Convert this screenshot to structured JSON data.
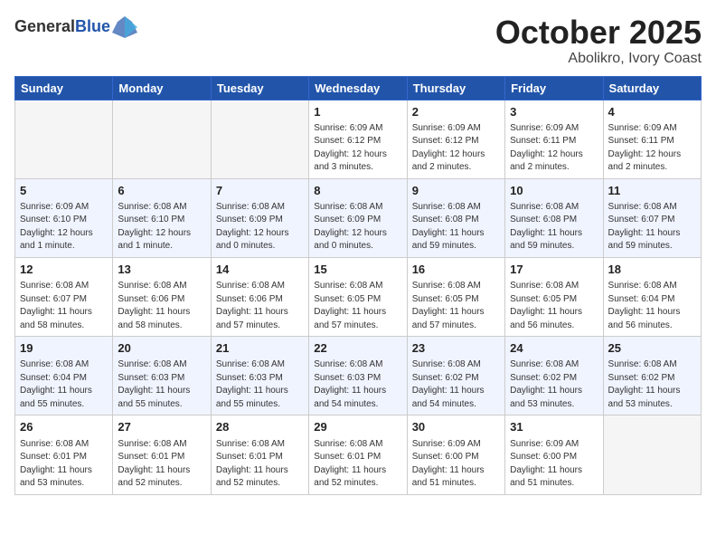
{
  "logo": {
    "general": "General",
    "blue": "Blue"
  },
  "header": {
    "month": "October 2025",
    "location": "Abolikro, Ivory Coast"
  },
  "weekdays": [
    "Sunday",
    "Monday",
    "Tuesday",
    "Wednesday",
    "Thursday",
    "Friday",
    "Saturday"
  ],
  "weeks": [
    [
      {
        "day": "",
        "info": ""
      },
      {
        "day": "",
        "info": ""
      },
      {
        "day": "",
        "info": ""
      },
      {
        "day": "1",
        "info": "Sunrise: 6:09 AM\nSunset: 6:12 PM\nDaylight: 12 hours and 3 minutes."
      },
      {
        "day": "2",
        "info": "Sunrise: 6:09 AM\nSunset: 6:12 PM\nDaylight: 12 hours and 2 minutes."
      },
      {
        "day": "3",
        "info": "Sunrise: 6:09 AM\nSunset: 6:11 PM\nDaylight: 12 hours and 2 minutes."
      },
      {
        "day": "4",
        "info": "Sunrise: 6:09 AM\nSunset: 6:11 PM\nDaylight: 12 hours and 2 minutes."
      }
    ],
    [
      {
        "day": "5",
        "info": "Sunrise: 6:09 AM\nSunset: 6:10 PM\nDaylight: 12 hours and 1 minute."
      },
      {
        "day": "6",
        "info": "Sunrise: 6:08 AM\nSunset: 6:10 PM\nDaylight: 12 hours and 1 minute."
      },
      {
        "day": "7",
        "info": "Sunrise: 6:08 AM\nSunset: 6:09 PM\nDaylight: 12 hours and 0 minutes."
      },
      {
        "day": "8",
        "info": "Sunrise: 6:08 AM\nSunset: 6:09 PM\nDaylight: 12 hours and 0 minutes."
      },
      {
        "day": "9",
        "info": "Sunrise: 6:08 AM\nSunset: 6:08 PM\nDaylight: 11 hours and 59 minutes."
      },
      {
        "day": "10",
        "info": "Sunrise: 6:08 AM\nSunset: 6:08 PM\nDaylight: 11 hours and 59 minutes."
      },
      {
        "day": "11",
        "info": "Sunrise: 6:08 AM\nSunset: 6:07 PM\nDaylight: 11 hours and 59 minutes."
      }
    ],
    [
      {
        "day": "12",
        "info": "Sunrise: 6:08 AM\nSunset: 6:07 PM\nDaylight: 11 hours and 58 minutes."
      },
      {
        "day": "13",
        "info": "Sunrise: 6:08 AM\nSunset: 6:06 PM\nDaylight: 11 hours and 58 minutes."
      },
      {
        "day": "14",
        "info": "Sunrise: 6:08 AM\nSunset: 6:06 PM\nDaylight: 11 hours and 57 minutes."
      },
      {
        "day": "15",
        "info": "Sunrise: 6:08 AM\nSunset: 6:05 PM\nDaylight: 11 hours and 57 minutes."
      },
      {
        "day": "16",
        "info": "Sunrise: 6:08 AM\nSunset: 6:05 PM\nDaylight: 11 hours and 57 minutes."
      },
      {
        "day": "17",
        "info": "Sunrise: 6:08 AM\nSunset: 6:05 PM\nDaylight: 11 hours and 56 minutes."
      },
      {
        "day": "18",
        "info": "Sunrise: 6:08 AM\nSunset: 6:04 PM\nDaylight: 11 hours and 56 minutes."
      }
    ],
    [
      {
        "day": "19",
        "info": "Sunrise: 6:08 AM\nSunset: 6:04 PM\nDaylight: 11 hours and 55 minutes."
      },
      {
        "day": "20",
        "info": "Sunrise: 6:08 AM\nSunset: 6:03 PM\nDaylight: 11 hours and 55 minutes."
      },
      {
        "day": "21",
        "info": "Sunrise: 6:08 AM\nSunset: 6:03 PM\nDaylight: 11 hours and 55 minutes."
      },
      {
        "day": "22",
        "info": "Sunrise: 6:08 AM\nSunset: 6:03 PM\nDaylight: 11 hours and 54 minutes."
      },
      {
        "day": "23",
        "info": "Sunrise: 6:08 AM\nSunset: 6:02 PM\nDaylight: 11 hours and 54 minutes."
      },
      {
        "day": "24",
        "info": "Sunrise: 6:08 AM\nSunset: 6:02 PM\nDaylight: 11 hours and 53 minutes."
      },
      {
        "day": "25",
        "info": "Sunrise: 6:08 AM\nSunset: 6:02 PM\nDaylight: 11 hours and 53 minutes."
      }
    ],
    [
      {
        "day": "26",
        "info": "Sunrise: 6:08 AM\nSunset: 6:01 PM\nDaylight: 11 hours and 53 minutes."
      },
      {
        "day": "27",
        "info": "Sunrise: 6:08 AM\nSunset: 6:01 PM\nDaylight: 11 hours and 52 minutes."
      },
      {
        "day": "28",
        "info": "Sunrise: 6:08 AM\nSunset: 6:01 PM\nDaylight: 11 hours and 52 minutes."
      },
      {
        "day": "29",
        "info": "Sunrise: 6:08 AM\nSunset: 6:01 PM\nDaylight: 11 hours and 52 minutes."
      },
      {
        "day": "30",
        "info": "Sunrise: 6:09 AM\nSunset: 6:00 PM\nDaylight: 11 hours and 51 minutes."
      },
      {
        "day": "31",
        "info": "Sunrise: 6:09 AM\nSunset: 6:00 PM\nDaylight: 11 hours and 51 minutes."
      },
      {
        "day": "",
        "info": ""
      }
    ]
  ]
}
